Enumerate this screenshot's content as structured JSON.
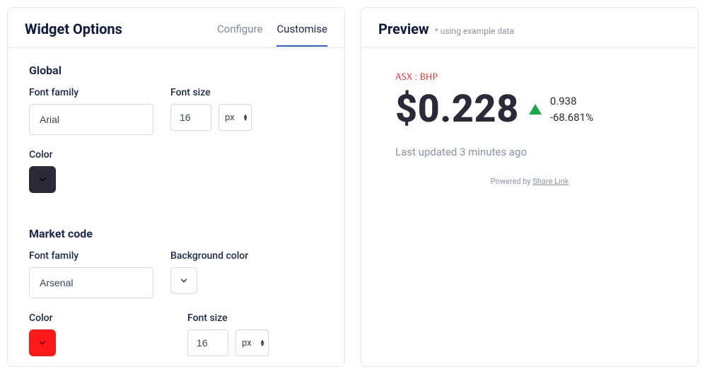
{
  "left": {
    "title": "Widget Options",
    "tabs": {
      "configure": "Configure",
      "customise": "Customise"
    },
    "global": {
      "heading": "Global",
      "font_family_label": "Font family",
      "font_family_value": "Arial",
      "font_size_label": "Font size",
      "font_size_value": "16",
      "font_size_unit": "px",
      "color_label": "Color",
      "color_value": "#2a2a38"
    },
    "market_code": {
      "heading": "Market code",
      "font_family_label": "Font family",
      "font_family_value": "Arsenal",
      "bg_color_label": "Background color",
      "bg_color_value": "#ffffff",
      "color_label": "Color",
      "color_value": "#ff1a1a",
      "font_size_label": "Font size",
      "font_size_value": "16",
      "font_size_unit": "px"
    }
  },
  "preview": {
    "title": "Preview",
    "subtitle": "* using example data",
    "market_code": "ASX : BHP",
    "price": "$0.228",
    "change_value": "0.938",
    "change_percent": "-68.681%",
    "updated": "Last updated 3 minutes ago",
    "powered_prefix": "Powered by ",
    "powered_link": "Share Link"
  }
}
